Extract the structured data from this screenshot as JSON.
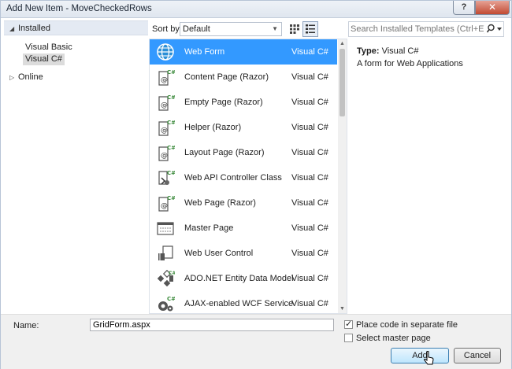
{
  "window": {
    "title": "Add New Item - MoveCheckedRows",
    "help_label": "?",
    "close_label": "✕"
  },
  "sidebar": {
    "installed_label": "Installed",
    "installed_arrow": "◢",
    "subitems": [
      {
        "label": "Visual Basic"
      },
      {
        "label": "Visual C#"
      }
    ],
    "online_label": "Online",
    "online_arrow": "▷"
  },
  "toolbar": {
    "sort_label": "Sort by:",
    "sort_value": "Default"
  },
  "search": {
    "placeholder": "Search Installed Templates (Ctrl+E)"
  },
  "templates": [
    {
      "name": "Web Form",
      "lang": "Visual C#",
      "icon": "globe-icon",
      "selected": true
    },
    {
      "name": "Content Page (Razor)",
      "lang": "Visual C#",
      "icon": "razor-page-icon"
    },
    {
      "name": "Empty Page (Razor)",
      "lang": "Visual C#",
      "icon": "razor-page-icon"
    },
    {
      "name": "Helper (Razor)",
      "lang": "Visual C#",
      "icon": "razor-page-icon"
    },
    {
      "name": "Layout Page (Razor)",
      "lang": "Visual C#",
      "icon": "razor-page-icon"
    },
    {
      "name": "Web API Controller Class",
      "lang": "Visual C#",
      "icon": "api-controller-icon"
    },
    {
      "name": "Web Page (Razor)",
      "lang": "Visual C#",
      "icon": "razor-page-icon"
    },
    {
      "name": "Master Page",
      "lang": "Visual C#",
      "icon": "master-page-icon"
    },
    {
      "name": "Web User Control",
      "lang": "Visual C#",
      "icon": "user-control-icon"
    },
    {
      "name": "ADO.NET Entity Data Model",
      "lang": "Visual C#",
      "icon": "entity-model-icon"
    },
    {
      "name": "AJAX-enabled WCF Service",
      "lang": "Visual C#",
      "icon": "wcf-service-icon"
    }
  ],
  "info": {
    "type_label": "Type:",
    "type_value": "Visual C#",
    "description": "A form for Web Applications"
  },
  "form": {
    "name_label": "Name:",
    "name_value": "GridForm.aspx",
    "place_code_label": "Place code in separate file",
    "place_code_checked": true,
    "master_label": "Select master page",
    "master_checked": false
  },
  "buttons": {
    "add_label": "Add",
    "cancel_label": "Cancel"
  },
  "colors": {
    "selection": "#3399ff",
    "close": "#c24a32"
  }
}
